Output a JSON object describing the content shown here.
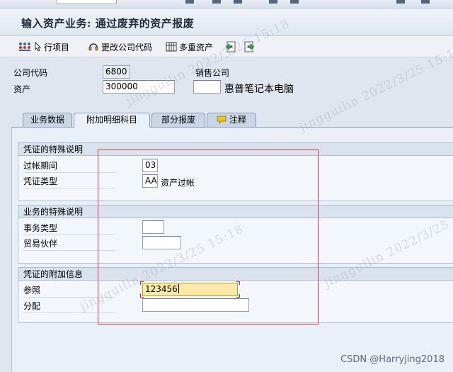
{
  "window": {
    "title": "输入资产业务: 通过废弃的资产报废"
  },
  "toolbar": {
    "line_items": "行项目",
    "change_company_code": "更改公司代码",
    "multiple_assets": "多重资产"
  },
  "header": {
    "company_code_label": "公司代码",
    "company_code_value": "6800",
    "asset_label": "资产",
    "asset_value": "300000",
    "sales_company_label": "销售公司",
    "sales_company_value": "",
    "asset_description": "惠普笔记本电脑"
  },
  "tabs": [
    {
      "label": "业务数据",
      "active": false
    },
    {
      "label": "附加明细科目",
      "active": true
    },
    {
      "label": "部分报废",
      "active": false
    },
    {
      "label": "注释",
      "active": false
    }
  ],
  "groups": {
    "doc_special": {
      "title": "凭证的特殊说明",
      "posting_period_label": "过帐期间",
      "posting_period_value": "03",
      "doc_type_label": "凭证类型",
      "doc_type_value": "AA",
      "doc_type_text": "资产过帐"
    },
    "trans_special": {
      "title": "业务的特殊说明",
      "trans_type_label": "事务类型",
      "trans_type_value": "",
      "trading_partner_label": "贸易伙伴",
      "trading_partner_value": ""
    },
    "doc_additional": {
      "title": "凭证的附加信息",
      "reference_label": "参照",
      "reference_value": "123456",
      "assignment_label": "分配",
      "assignment_value": ""
    }
  },
  "watermark": {
    "text1": "jingguilin 2022/3/25 15:18",
    "text2": "jingguilin 2022/3/25 15:18",
    "text3": "jingguilin 2022/3/25 15:18",
    "text4": "jingguilin 2022/3/25 15:18"
  },
  "credit": "CSDN @Harryjing2018"
}
